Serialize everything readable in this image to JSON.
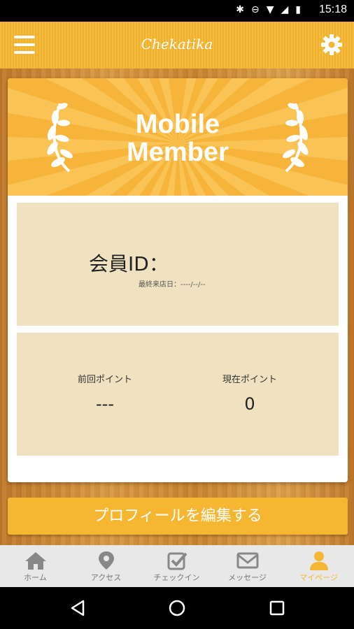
{
  "status_bar": {
    "time": "15:18"
  },
  "app_bar": {
    "title": "Chekatika"
  },
  "banner": {
    "line1": "Mobile",
    "line2": "Member"
  },
  "member": {
    "id_label": "会員ID：",
    "last_visit_label": "最終来店日：----/--/--"
  },
  "points": {
    "previous_label": "前回ポイント",
    "previous_value": "---",
    "current_label": "現在ポイント",
    "current_value": "0"
  },
  "edit_profile_button": "プロフィールを編集する",
  "tabs": [
    {
      "label": "ホーム",
      "icon": "home-icon"
    },
    {
      "label": "アクセス",
      "icon": "map-pin-icon"
    },
    {
      "label": "チェックイン",
      "icon": "checkin-icon"
    },
    {
      "label": "メッセージ",
      "icon": "mail-icon"
    },
    {
      "label": "マイページ",
      "icon": "user-icon"
    }
  ],
  "colors": {
    "accent": "#f5b731",
    "panel": "#f0e1c1",
    "tab_inactive": "#777777"
  }
}
